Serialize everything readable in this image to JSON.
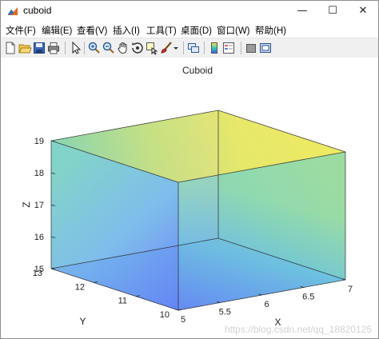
{
  "window": {
    "title": "cuboid",
    "controls": {
      "minimize": "—",
      "maximize": "☐",
      "close": "✕"
    }
  },
  "menu": [
    "文件(F)",
    "编辑(E)",
    "查看(V)",
    "插入(I)",
    "工具(T)",
    "桌面(D)",
    "窗口(W)",
    "帮助(H)"
  ],
  "toolbar": {
    "icons": [
      "new-figure-icon",
      "open-file-icon",
      "save-icon",
      "print-icon",
      "select-arrow-icon",
      "zoom-in-icon",
      "zoom-out-icon",
      "pan-hand-icon",
      "rotate-3d-icon",
      "data-cursor-icon",
      "brush-icon",
      "brush-dropdown-icon",
      "link-plot-icon",
      "insert-colorbar-icon",
      "insert-legend-icon",
      "hide-plot-tools-icon",
      "show-plot-tools-icon"
    ]
  },
  "chart_data": {
    "type": "surface",
    "title": "Cuboid",
    "xlabel": "X",
    "ylabel": "Y",
    "zlabel": "Z",
    "xlim": [
      5,
      7
    ],
    "ylim": [
      10,
      13
    ],
    "zlim": [
      15,
      19
    ],
    "x_ticks": [
      "5",
      "5.5",
      "6",
      "6.5",
      "7"
    ],
    "y_ticks": [
      "10",
      "11",
      "12",
      "13"
    ],
    "z_ticks": [
      "15",
      "16",
      "17",
      "18",
      "19"
    ],
    "x_tick_values": [
      5,
      5.5,
      6,
      6.5,
      7
    ],
    "y_tick_values": [
      10,
      11,
      12,
      13
    ],
    "z_tick_values": [
      15,
      16,
      17,
      18,
      19
    ],
    "colormap": "parula",
    "face_alpha": 0.6,
    "colors": {
      "low": "#3e5cf6",
      "mid": "#36c8b4",
      "high": "#f9e94b"
    }
  },
  "watermark": "https://blog.csdn.net/qq_18820125"
}
